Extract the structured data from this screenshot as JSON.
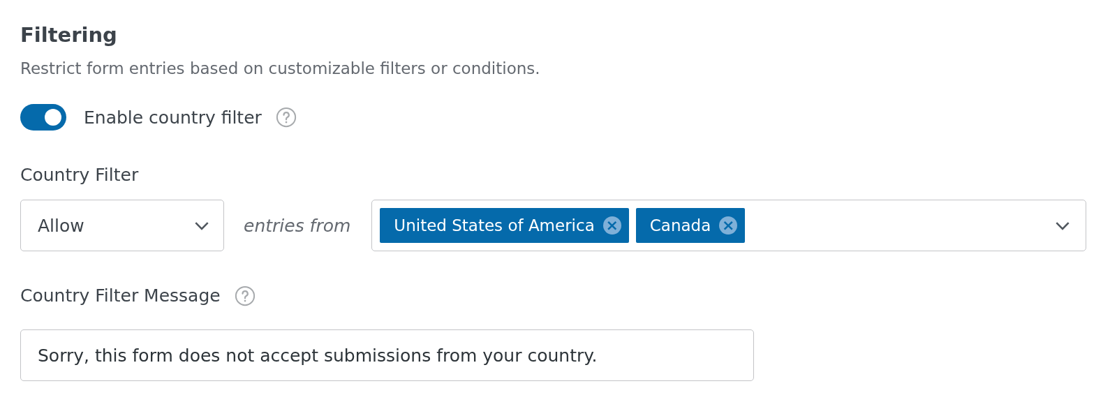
{
  "section": {
    "title": "Filtering",
    "description": "Restrict form entries based on customizable filters or conditions."
  },
  "toggle": {
    "label": "Enable country filter",
    "on": true
  },
  "country_filter": {
    "label": "Country Filter",
    "mode": {
      "value": "Allow"
    },
    "connector": "entries from",
    "tags": [
      {
        "label": "United States of America",
        "remove": "×"
      },
      {
        "label": "Canada",
        "remove": "×"
      }
    ]
  },
  "message": {
    "label": "Country Filter Message",
    "value": "Sorry, this form does not accept submissions from your country."
  }
}
